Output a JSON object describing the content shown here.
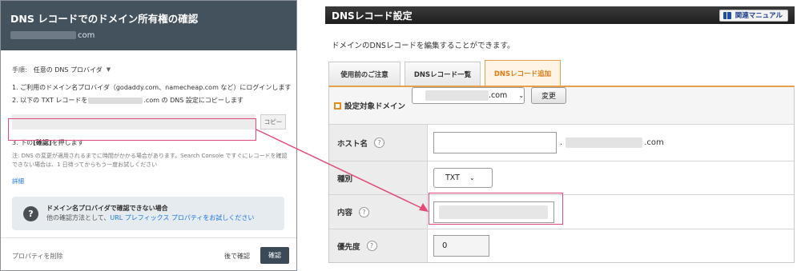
{
  "search_console": {
    "title": "DNS レコードでのドメイン所有権の確認",
    "domain_suffix": "com",
    "method_label": "手順:",
    "method_value": "任意の DNS プロバイダ",
    "step1": "1. ご利用のドメイン名プロバイダ（godaddy.com、namecheap.com など）にログインします",
    "step2_prefix": "2. 以下の TXT レコードを",
    "step2_suffix": ".com の DNS 設定にコピーします",
    "copy_button": "コピー",
    "step3_prefix": "3. 下の",
    "step3_bold": "[確認]",
    "step3_suffix": "を押します",
    "note": "注: DNS の変更が適用されるまでに時間がかかる場合があります。Search Console ですぐにレコードを確認できない場合は、1 日待ってからもう一度お試しください",
    "detail_link": "詳細",
    "info_title": "ドメイン名プロバイダで確認できない場合",
    "info_sub": "他の確認方法として、",
    "info_link": "URL プレフィックス プロパティをお試しください",
    "remove_link": "プロパティを削除",
    "later_link": "後で確認",
    "confirm_button": "確認"
  },
  "xserver": {
    "title": "DNSレコード設定",
    "manual_button": "関連マニュアル",
    "description": "ドメインのDNSレコードを編集することができます。",
    "tabs": [
      {
        "label": "使用前のご注意",
        "active": false
      },
      {
        "label": "DNSレコード一覧",
        "active": false
      },
      {
        "label": "DNSレコード追加",
        "active": true
      }
    ],
    "target_domain_label": "設定対象ドメイン",
    "target_domain_suffix": ".com",
    "change_button": "変更",
    "host_label": "ホスト名",
    "host_dot": ".",
    "host_suffix": ".com",
    "type_label": "種別",
    "type_value": "TXT",
    "content_label": "内容",
    "priority_label": "優先度",
    "priority_value": "0",
    "help_glyph": "?"
  },
  "colors": {
    "sc_header": "#44525e",
    "highlight": "#e34a77",
    "xs_accent": "#e6a04a",
    "link": "#1a73e8"
  }
}
